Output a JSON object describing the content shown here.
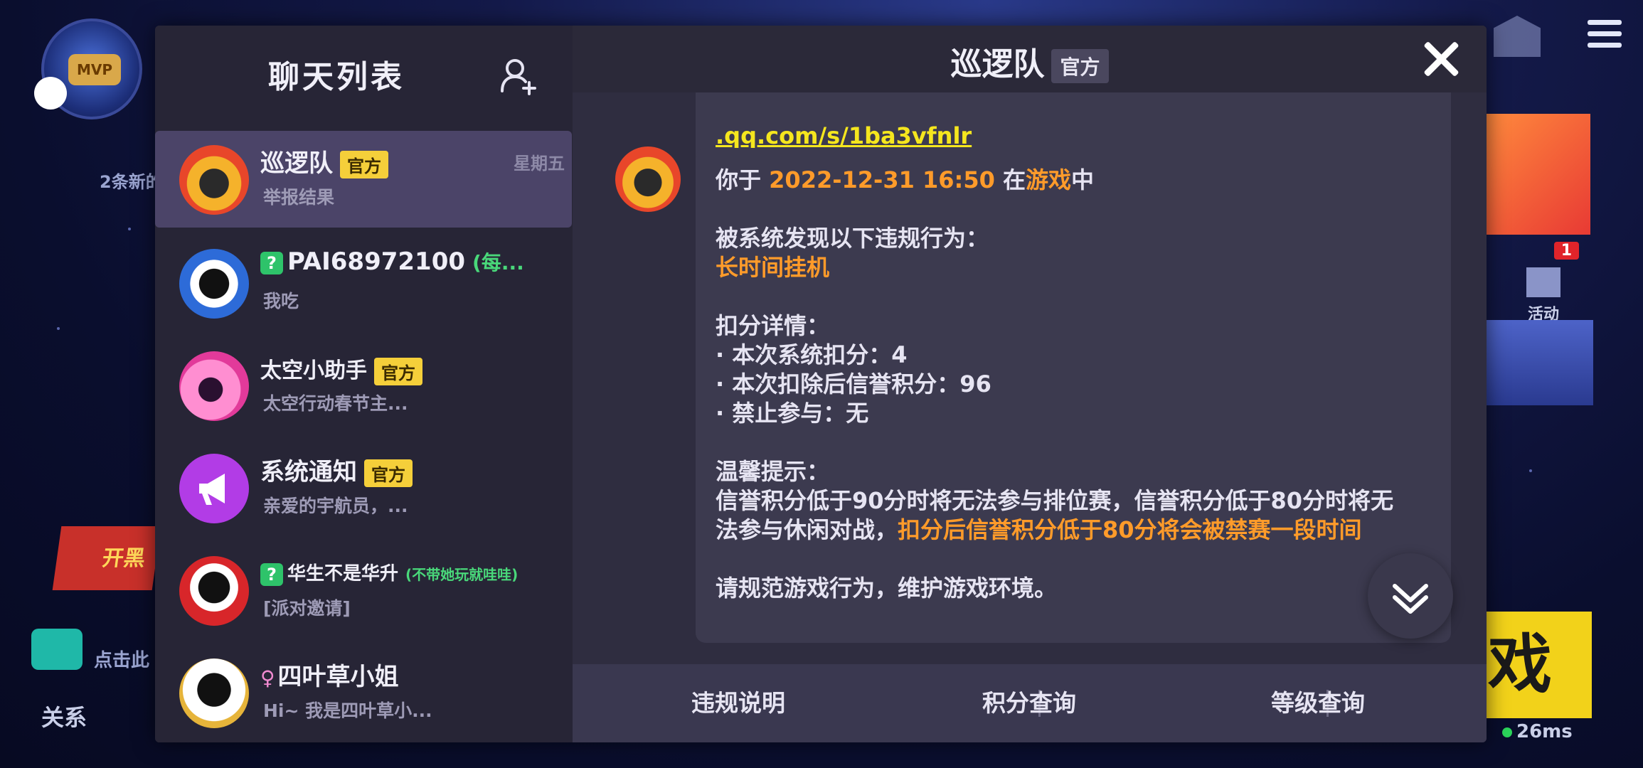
{
  "background": {
    "new_messages": "2条新的",
    "relation": "关系",
    "click_here": "点击此",
    "open_banner": "开黑",
    "activity_label": "活动",
    "activity_badge": "1",
    "big_button": "戏",
    "ping": "26ms",
    "avatar_badge": "MVP"
  },
  "sidebar": {
    "title": "聊天列表",
    "items": [
      {
        "name": "巡逻队",
        "badge": "官方",
        "sub": "举报结果",
        "time": "星期五"
      },
      {
        "name": "PAI68972100",
        "note": "(每...",
        "sub": "我吃"
      },
      {
        "name": "太空小助手",
        "badge": "官方",
        "sub": "太空行动春节主..."
      },
      {
        "name": "系统通知",
        "badge": "官方",
        "sub": "亲爱的宇航员，..."
      },
      {
        "name": "华生不是华升",
        "note": "(不带她玩就哇哇)",
        "sub": "[派对邀请]"
      },
      {
        "name": "四叶草小姐",
        "sub": "Hi~ 我是四叶草小..."
      }
    ]
  },
  "chat": {
    "title": "巡逻队",
    "title_badge": "官方",
    "prev_link": ".qq.com/s/1ba3vfnlr",
    "message": {
      "l1_a": "你于 ",
      "l1_time": "2022-12-31 16:50",
      "l1_b": " 在",
      "l1_game": "游戏",
      "l1_c": "中",
      "l2": "被系统发现以下违规行为：",
      "l3": "长时间挂机",
      "l4": "扣分详情：",
      "l5": "·  本次系统扣分：4",
      "l6": "·  本次扣除后信誉积分：96",
      "l7": "·  禁止参与：无",
      "l8": "温馨提示：",
      "l9": "信誉积分低于90分时将无法参与排位赛，信誉积分低于80分时将无",
      "l10_a": "法参与休闲对战，",
      "l10_b": "扣分后信誉积分低于80分将会被禁赛一段时间",
      "l11": "请规范游戏行为，维护游戏环境。"
    }
  },
  "footer": {
    "btn1": "违规说明",
    "btn2": "积分查询",
    "btn3": "等级查询"
  },
  "colors": {
    "accent_orange": "#ff9b2a",
    "link_yellow": "#f5e61e",
    "official_badge": "#f5cf3a",
    "active_item": "#4b4468"
  }
}
